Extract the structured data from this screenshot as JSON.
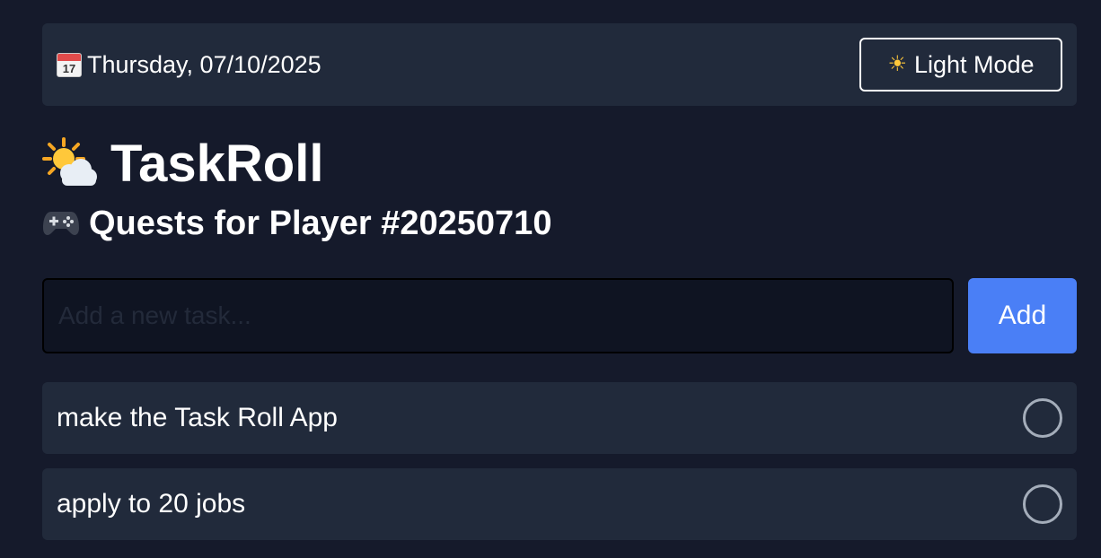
{
  "header": {
    "date_text": "Thursday, 07/10/2025",
    "calendar_day": "17",
    "calendar_icon": "calendar-icon",
    "mode_button_label": "Light Mode",
    "mode_button_icon": "sun-icon"
  },
  "app": {
    "title": "TaskRoll",
    "title_icon": "sun-behind-cloud-icon",
    "subtitle": "Quests for Player #20250710",
    "subtitle_icon": "game-controller-icon"
  },
  "add_task": {
    "placeholder": "Add a new task...",
    "value": "",
    "button_label": "Add"
  },
  "tasks": [
    {
      "label": "make the Task Roll App",
      "done": false
    },
    {
      "label": "apply to 20 jobs",
      "done": false
    }
  ],
  "colors": {
    "background": "#151a2b",
    "panel": "#212a3b",
    "accent": "#4a7ff6",
    "text": "#ffffff",
    "circle_border": "#a4adba"
  }
}
